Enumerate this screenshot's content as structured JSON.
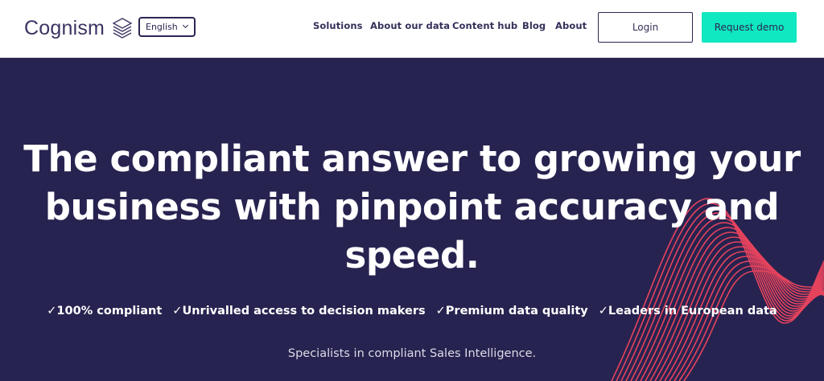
{
  "header": {
    "logo_text": "Cognism",
    "language": "English",
    "nav": [
      {
        "label": "Solutions"
      },
      {
        "label": "About our data"
      },
      {
        "label": "Content hub"
      },
      {
        "label": "Blog"
      },
      {
        "label": "About"
      }
    ],
    "login_label": "Login",
    "demo_label": "Request demo"
  },
  "hero": {
    "headline_line1": "The compliant answer to growing your",
    "headline_line2": "business with pinpoint accuracy and",
    "headline_line3": "speed.",
    "features": [
      "✓100% compliant",
      "✓Unrivalled access to decision makers",
      "✓Premium data quality",
      "✓Leaders in European data"
    ],
    "subline": "Specialists in compliant Sales Intelligence."
  },
  "colors": {
    "brand_navy": "#272350",
    "accent_teal": "#0fe8c0",
    "wave_coral": "#f0455e",
    "text_dark": "#34315a"
  }
}
